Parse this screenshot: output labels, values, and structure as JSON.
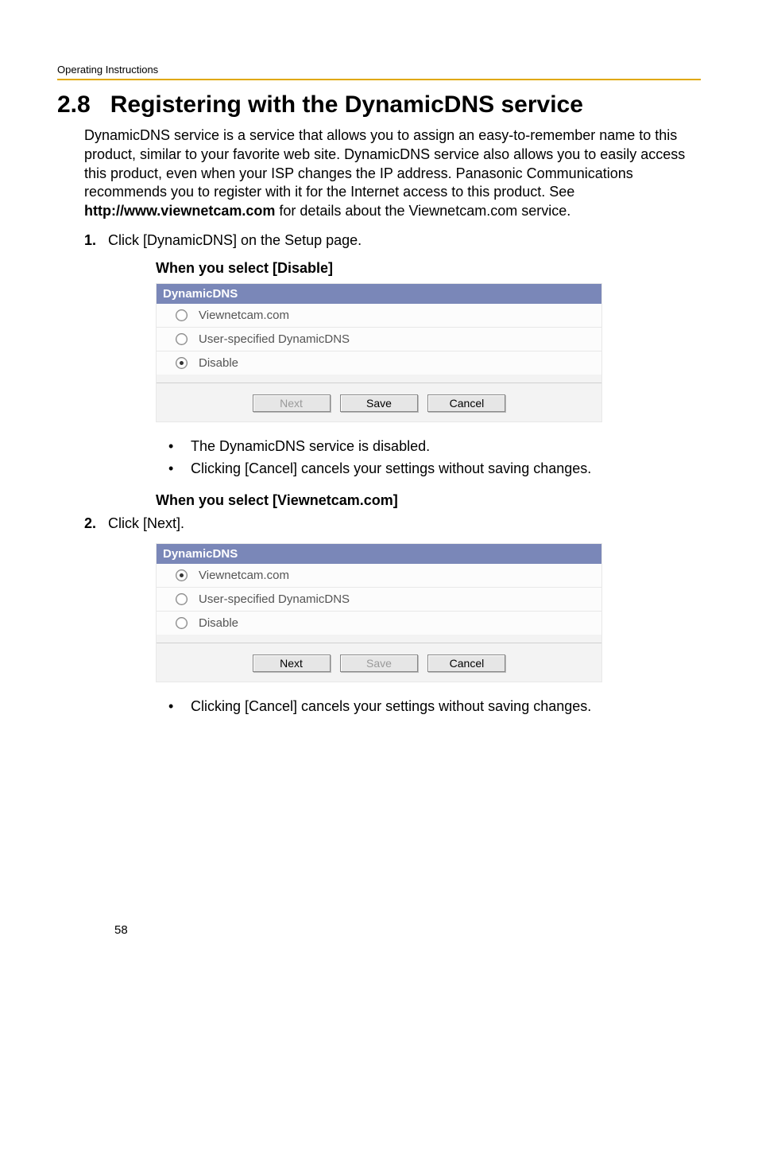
{
  "running_head": "Operating Instructions",
  "section_number": "2.8",
  "section_title": "Registering with the DynamicDNS service",
  "intro_before_bold": "DynamicDNS service is a service that allows you to assign an easy-to-remember name to this product, similar to your favorite web site. DynamicDNS service also allows you to easily access this product, even when your ISP changes the IP address. Panasonic Communications recommends you to register with it for the Internet access to this product. See ",
  "intro_bold": "http://www.viewnetcam.com",
  "intro_after_bold": " for details about the Viewnetcam.com service.",
  "step1_num": "1.",
  "step1_text": "Click [DynamicDNS] on the Setup page.",
  "subhead_disable": "When you select [Disable]",
  "panel": {
    "title": "DynamicDNS",
    "opt1": "Viewnetcam.com",
    "opt2": "User-specified DynamicDNS",
    "opt3": "Disable",
    "btn_next": "Next",
    "btn_save": "Save",
    "btn_cancel": "Cancel"
  },
  "bullets_disable_1": "The DynamicDNS service is disabled.",
  "bullets_disable_2": "Clicking [Cancel] cancels your settings without saving changes.",
  "subhead_view": "When you select [Viewnetcam.com]",
  "step2_num": "2.",
  "step2_text": "Click [Next].",
  "bullets_view_1": "Clicking [Cancel] cancels your settings without saving changes.",
  "page_number": "58"
}
